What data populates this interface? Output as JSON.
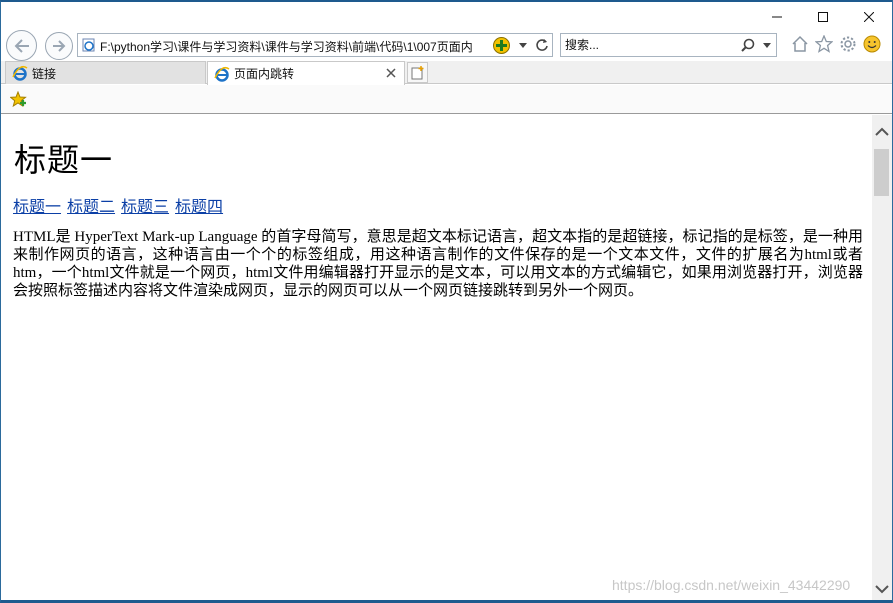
{
  "browser": {
    "address_url": "F:\\python学习\\课件与学习资料\\课件与学习资料\\前端\\代码\\1\\007页面内",
    "search_placeholder": "搜索..."
  },
  "tabs": [
    {
      "label": "链接"
    },
    {
      "label": "页面内跳转"
    }
  ],
  "page": {
    "heading": "标题一",
    "links": [
      "标题一",
      "标题二",
      "标题三",
      "标题四"
    ],
    "paragraph": "HTML是 HyperText Mark-up Language 的首字母简写，意思是超文本标记语言，超文本指的是超链接，标记指的是标签，是一种用来制作网页的语言，这种语言由一个个的标签组成，用这种语言制作的文件保存的是一个文本文件，文件的扩展名为html或者htm，一个html文件就是一个网页，html文件用编辑器打开显示的是文本，可以用文本的方式编辑它，如果用浏览器打开，浏览器会按照标签描述内容将文件渲染成网页，显示的网页可以从一个网页链接跳转到另外一个网页。"
  },
  "watermark": "https://blog.csdn.net/weixin_43442290",
  "colors": {
    "link": "#0b3fa6",
    "ie_blue": "#1e73c8",
    "frame": "#1e5a8e"
  }
}
